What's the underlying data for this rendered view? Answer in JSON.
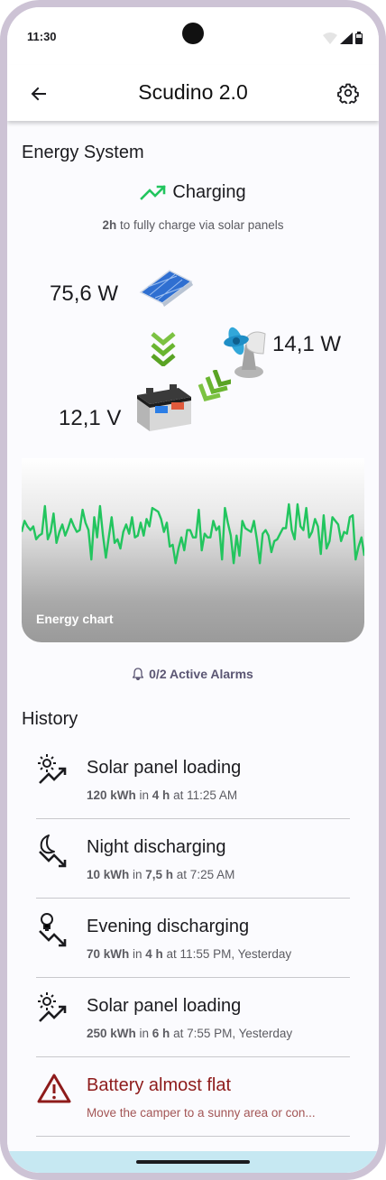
{
  "status": {
    "time": "11:30"
  },
  "app": {
    "title": "Scudino 2.0"
  },
  "energy": {
    "section_title": "Energy System",
    "state": "Charging",
    "charge_time_bold": "2h",
    "charge_time_rest": " to fully charge via solar panels",
    "solar_power": "75,6 W",
    "fan_power": "14,1 W",
    "battery_voltage": "12,1 V",
    "accent_color": "#22c55e"
  },
  "chart": {
    "label": "Energy chart",
    "line_color": "#22c55e"
  },
  "chart_data": {
    "type": "line",
    "title": "Energy chart",
    "series": [
      {
        "values": [
          60,
          66,
          63,
          61,
          63,
          56,
          58,
          59,
          74,
          56,
          60,
          70,
          54,
          60,
          64,
          58,
          62,
          67,
          63,
          60,
          61,
          72,
          65,
          61,
          45,
          68,
          57,
          74,
          58,
          46,
          57,
          68,
          54,
          56,
          51,
          60,
          64,
          59,
          68,
          57,
          58,
          65,
          58,
          67,
          63,
          73,
          72,
          71,
          67,
          60,
          65,
          52,
          53,
          43,
          51,
          57,
          50,
          61,
          61,
          57,
          57,
          72,
          50,
          59,
          57,
          57,
          66,
          61,
          63,
          45,
          73,
          65,
          58,
          43,
          58,
          47,
          66,
          62,
          61,
          60,
          66,
          56,
          43,
          59,
          61,
          58,
          49,
          55,
          56,
          59,
          62,
          62,
          75,
          61,
          56,
          75,
          63,
          61,
          73,
          57,
          60,
          67,
          63,
          48,
          69,
          51,
          55,
          68,
          66,
          64,
          55,
          60,
          59,
          68,
          69,
          45,
          52,
          57,
          47
        ]
      }
    ],
    "ylim": [
      0,
      100
    ]
  },
  "alarms": {
    "label": "0/2 Active Alarms"
  },
  "history": {
    "title": "History",
    "items": [
      {
        "icon": "sun-trend-up-icon",
        "title": "Solar panel loading",
        "amount": "120 kWh",
        "in": " in ",
        "duration": "4 h",
        "when": " at 11:25 AM",
        "warn": false
      },
      {
        "icon": "moon-trend-down-icon",
        "title": "Night discharging",
        "amount": "10 kWh",
        "in": " in ",
        "duration": "7,5 h",
        "when": " at 7:25 AM",
        "warn": false
      },
      {
        "icon": "bulb-trend-down-icon",
        "title": "Evening discharging",
        "amount": "70 kWh",
        "in": " in ",
        "duration": "4 h",
        "when": " at 11:55 PM, Yesterday",
        "warn": false
      },
      {
        "icon": "sun-trend-up-icon",
        "title": "Solar panel loading",
        "amount": "250 kWh",
        "in": " in ",
        "duration": "6 h",
        "when": " at 7:55 PM, Yesterday",
        "warn": false
      },
      {
        "icon": "warning-triangle-icon",
        "title": "Battery almost flat",
        "message": "Move the camper to a sunny area or con...",
        "warn": true
      }
    ]
  }
}
